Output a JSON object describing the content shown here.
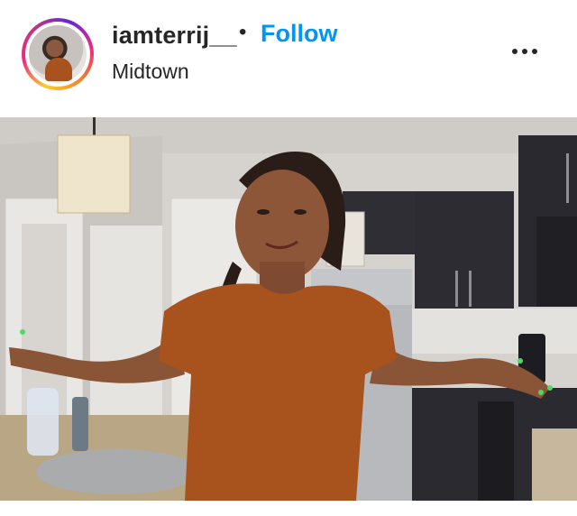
{
  "post_header": {
    "username": "iamterrij__",
    "separator": "•",
    "follow_label": "Follow",
    "location": "Midtown",
    "more_icon": "more-horizontal-icon"
  },
  "post_image": {
    "alt_subject": "post-photo"
  },
  "colors": {
    "follow_blue": "#0095f6",
    "text_dark": "#262626",
    "shirt_rust": "#a8521e",
    "cabinet_dark": "#2d2c33"
  }
}
